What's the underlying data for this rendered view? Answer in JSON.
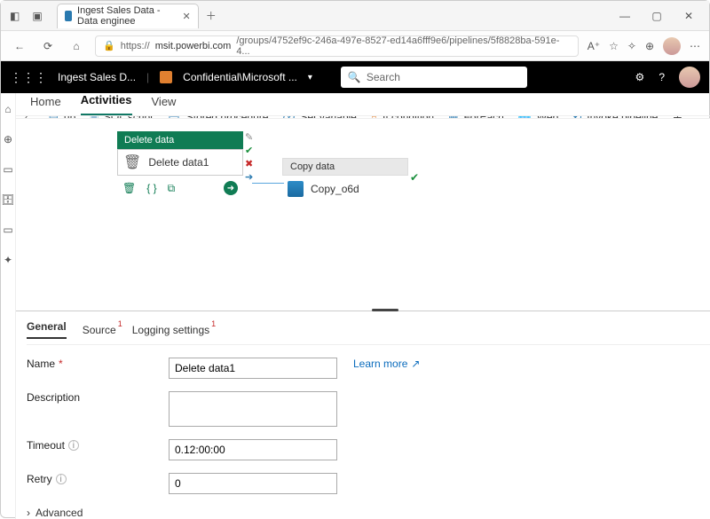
{
  "browser": {
    "tab_title": "Ingest Sales Data - Data enginee",
    "url_host": "msit.powerbi.com",
    "url_prefix": "https://",
    "url_path": "/groups/4752ef9c-246a-497e-8527-ed14a6fff9e6/pipelines/5f8828ba-591e-4..."
  },
  "onelake": {
    "workspace": "Ingest Sales D...",
    "sensitivity": "Confidential\\Microsoft ...",
    "search_placeholder": "Search"
  },
  "page_tabs": {
    "home": "Home",
    "activities": "Activities",
    "view": "View"
  },
  "toolbar": {
    "up": "up",
    "sql": "SQL script",
    "sproc": "Stored procedure",
    "setvar": "Set variable",
    "ifcond": "If condition",
    "foreach": "ForEach",
    "web": "Web",
    "invoke": "Invoke pipeline",
    "more": "More activities"
  },
  "canvas": {
    "delete_header": "Delete data",
    "delete_label": "Delete data1",
    "copy_header": "Copy data",
    "copy_label": "Copy_o6d"
  },
  "panel": {
    "tabs": {
      "general": "General",
      "source": "Source",
      "logging": "Logging settings"
    },
    "labels": {
      "name": "Name",
      "description": "Description",
      "timeout": "Timeout",
      "retry": "Retry",
      "advanced": "Advanced",
      "learn_more": "Learn more"
    },
    "values": {
      "name": "Delete data1",
      "timeout": "0.12:00:00",
      "retry": "0"
    }
  }
}
